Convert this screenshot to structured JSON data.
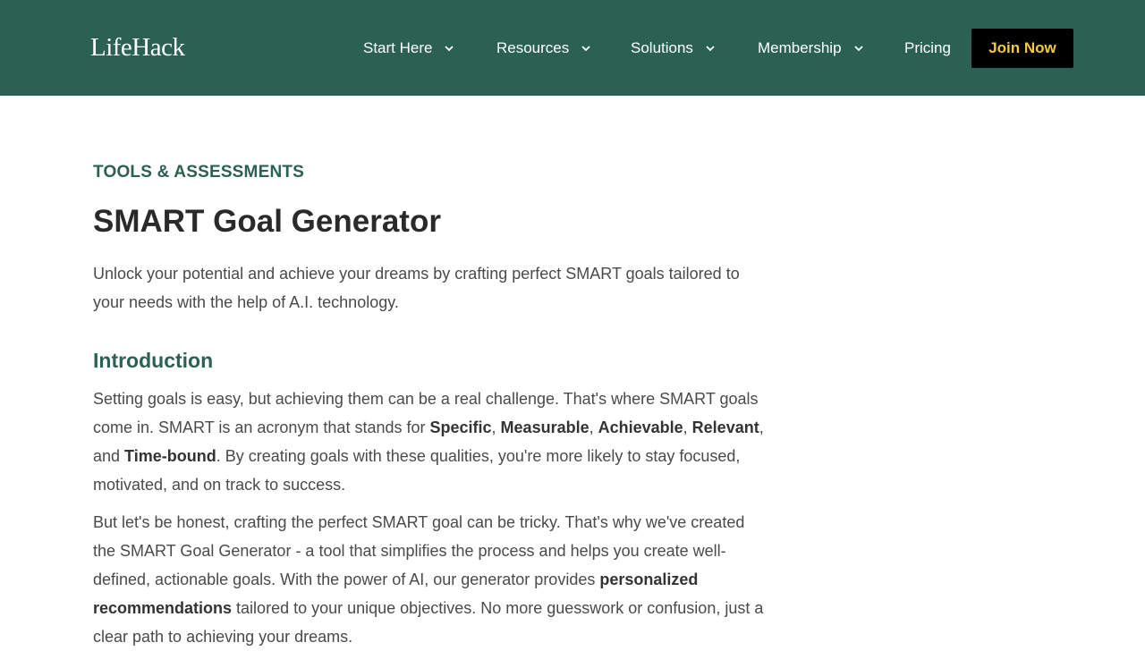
{
  "header": {
    "logo": "LifeHack",
    "nav": [
      {
        "label": "Start Here",
        "has_dropdown": true
      },
      {
        "label": "Resources",
        "has_dropdown": true
      },
      {
        "label": "Solutions",
        "has_dropdown": true
      },
      {
        "label": "Membership",
        "has_dropdown": true
      },
      {
        "label": "Pricing",
        "has_dropdown": false
      }
    ],
    "cta_label": "Join Now"
  },
  "colors": {
    "header_bg": "#2b6152",
    "accent_green": "#2b6152",
    "cta_bg": "#000000",
    "cta_text": "#f3c93f"
  },
  "article": {
    "eyebrow": "TOOLS & ASSESSMENTS",
    "title": "SMART Goal Generator",
    "lead": "Unlock your potential and achieve your dreams by crafting perfect SMART goals tailored to your needs with the help of A.I. technology.",
    "section_heading": "Introduction",
    "p1": {
      "t1": "Setting goals is easy, but achieving them can be a real challenge. That's where SMART goals come in. SMART is an acronym that stands for ",
      "b1": "Specific",
      "t2": ", ",
      "b2": "Measurable",
      "t3": ", ",
      "b3": "Achievable",
      "t4": ", ",
      "b4": "Relevant",
      "t5": ", and ",
      "b5": "Time-bound",
      "t6": ". By creating goals with these qualities, you're more likely to stay focused, motivated, and on track to success."
    },
    "p2": {
      "t1": "But let's be honest, crafting the perfect SMART goal can be tricky. That's why we've created the SMART Goal Generator - a tool that simplifies the process and helps you create well-defined, actionable goals. With the power of AI, our generator provides ",
      "b1": "personalized recommendations",
      "t2": " tailored to your unique objectives. No more guesswork or confusion, just a clear path to achieving your dreams."
    }
  }
}
